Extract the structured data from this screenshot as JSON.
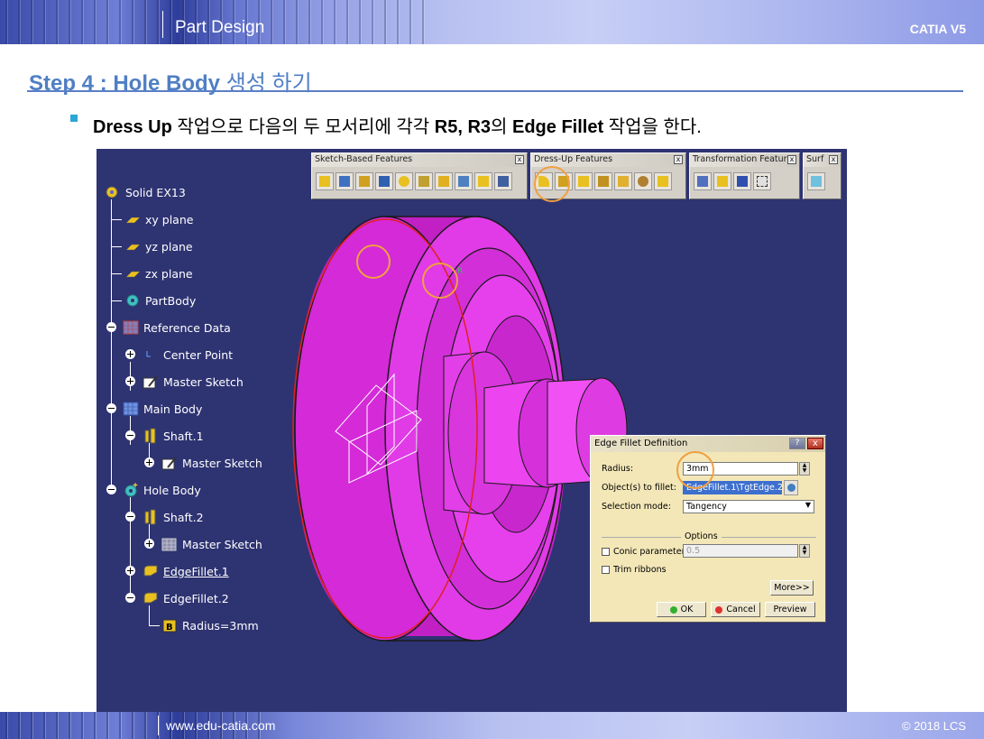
{
  "header": {
    "title": "Part Design",
    "brand": "CATIA V5"
  },
  "step": {
    "title": "Step 4 : Hole Body",
    "title_ko": "생성 하기"
  },
  "instruction": {
    "p1": "Dress Up",
    "p2": " 작업으로 다음의 두 모서리에 각각 ",
    "p3": "R5, R3",
    "p4": "의 ",
    "p5": "Edge Fillet",
    "p6": " 작업을 한다."
  },
  "tree": {
    "root": "Solid EX13",
    "xy": "xy plane",
    "yz": "yz plane",
    "zx": "zx plane",
    "partbody": "PartBody",
    "refdata": "Reference Data",
    "center": "Center Point",
    "master1": "Master Sketch",
    "mainbody": "Main Body",
    "shaft1": "Shaft.1",
    "master2": "Master Sketch",
    "holebody": "Hole Body",
    "shaft2": "Shaft.2",
    "master3": "Master Sketch",
    "fillet1": "EdgeFillet.1",
    "fillet2": "EdgeFillet.2",
    "radius": "Radius=3mm"
  },
  "toolbars": {
    "sketch": "Sketch-Based Features",
    "dressup": "Dress-Up Features",
    "transform": "Transformation Features",
    "surf": "Surf",
    "close": "x"
  },
  "dialog": {
    "title": "Edge Fillet Definition",
    "help": "?",
    "close": "x",
    "radius_label": "Radius:",
    "radius_value": "3mm",
    "objects_label": "Object(s) to fillet:",
    "objects_value": "EdgeFillet.1\\TgtEdge.2",
    "selection_label": "Selection mode:",
    "selection_value": "Tangency",
    "options_label": "Options",
    "conic_label": "Conic parameter:",
    "conic_value": "0.5",
    "trim_label": "Trim ribbons",
    "more": "More>>",
    "ok": "OK",
    "cancel": "Cancel",
    "preview": "Preview"
  },
  "colors": {
    "model": "#e030e0",
    "viewport_bg": "#2e3372",
    "accent_title": "#4f7fc4",
    "highlight": "#f0a040"
  },
  "footer": {
    "url": "www.edu-catia.com",
    "copyright": "© 2018 LCS"
  }
}
